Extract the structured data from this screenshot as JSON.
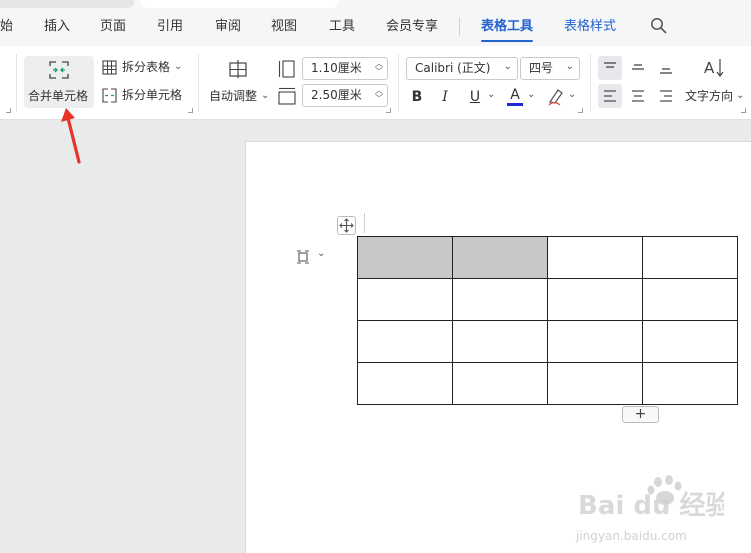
{
  "menu": {
    "items": [
      "始",
      "插入",
      "页面",
      "引用",
      "审阅",
      "视图",
      "工具",
      "会员专享"
    ],
    "accent_items": [
      "表格工具",
      "表格样式"
    ],
    "active": "表格工具"
  },
  "ribbon": {
    "merge_cells": "合并单元格",
    "split_table": "拆分表格",
    "split_cells": "拆分单元格",
    "auto_fit": "自动调整",
    "row_height": "1.10厘米",
    "col_width": "2.50厘米",
    "font_family": "Calibri (正文)",
    "font_size": "四号",
    "bold": "B",
    "italic": "I",
    "underline": "U",
    "font_color_letter": "A",
    "text_direction": "文字方向"
  },
  "table": {
    "rows": 4,
    "cols": 4,
    "selected_cells": [
      [
        0,
        0
      ],
      [
        0,
        1
      ]
    ]
  },
  "table_tools": {
    "add_row": "+"
  },
  "watermark": {
    "brand": "Bai du 经验",
    "site": "jingyan.baidu.com"
  },
  "colors": {
    "accent": "#2563cc",
    "selection": "#c8c8c8",
    "arrow": "#e8352a",
    "font_color_bar": "#1d2bd6"
  }
}
